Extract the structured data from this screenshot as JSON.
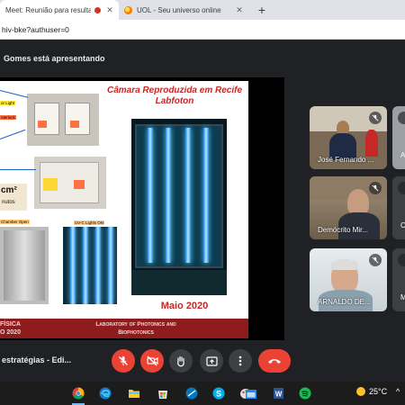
{
  "browser": {
    "tabs": [
      {
        "title": "Meet: Reunião para resultad",
        "recording": true,
        "active": true
      },
      {
        "title": "UOL - Seu universo online",
        "recording": false,
        "active": false
      }
    ],
    "new_tab_label": "+",
    "close_glyph": "✕",
    "url": "hiv-bke?authuser=0"
  },
  "meet": {
    "presenting_text": "Gomes está apresentando",
    "meeting_title": "estratégias - Edi...",
    "participants": [
      {
        "name": "José Fernando ...",
        "muted": true
      },
      {
        "name": "Demócrito Mir...",
        "muted": true
      },
      {
        "name": "ARNALDO DE...",
        "muted": true
      }
    ],
    "edge_tiles": [
      {
        "letter": "A"
      },
      {
        "letter": "C"
      },
      {
        "letter": "M"
      }
    ],
    "controls": {
      "mic": "mic-off-icon",
      "camera": "camera-off-icon",
      "raise_hand": "hand-icon",
      "present": "present-icon",
      "more": "more-vert-icon",
      "hangup": "hangup-icon"
    }
  },
  "slide": {
    "title_line1": "Câmara Reproduzida em Recife",
    "title_line2": "Labfoton",
    "date": "Maio 2020",
    "cm_label": "cm²",
    "cm_sub": "nutos",
    "labels": {
      "light": "or Light",
      "interlock": "nterlock",
      "chamber_open": "Chamber Open",
      "uvc_lights_on": "UV-C Lights ON"
    },
    "footer_left_1": "FÍSICA",
    "footer_left_2": "O 2020",
    "footer_right_1": "Laboratory of Photonics and",
    "footer_right_2": "Biophotonics"
  },
  "taskbar": {
    "apps": [
      "chrome-icon",
      "edge-icon",
      "file-explorer-icon",
      "store-icon",
      "browser-icon",
      "skype-icon",
      "paint-icon",
      "calendar-icon",
      "word-icon",
      "spotify-icon"
    ],
    "temperature": "25°C",
    "caret": "^"
  },
  "colors": {
    "meet_bg": "#202124",
    "hangup_red": "#ea4335",
    "slide_title_red": "#c62828",
    "footer_band": "#8e1c1c"
  }
}
